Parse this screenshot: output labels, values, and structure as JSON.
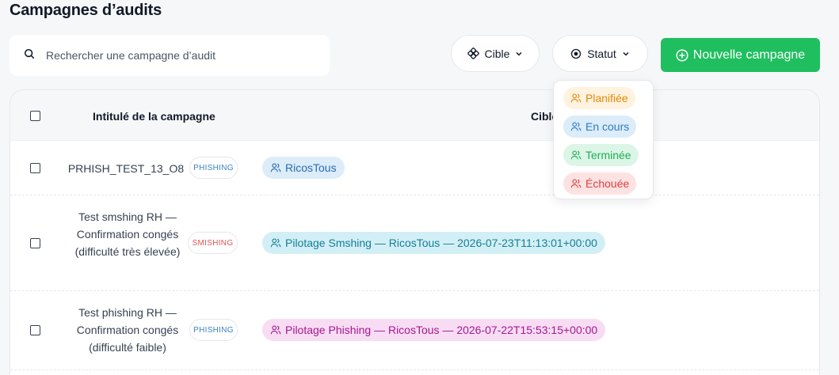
{
  "page": {
    "title": "Campagnes d’audits"
  },
  "search": {
    "placeholder": "Rechercher une campagne d’audit",
    "value": ""
  },
  "filters": {
    "cible_label": "Cible",
    "statut_label": "Statut"
  },
  "new_campaign": {
    "label": "Nouvelle campagne"
  },
  "table": {
    "headers": {
      "title": "Intitulé de la campagne",
      "cible": "Cible"
    },
    "rows": [
      {
        "name": "PRHISH_TEST_13_O8",
        "type": "PHISHING",
        "target": "RicosTous"
      },
      {
        "name": "Test smshing RH — Confirmation congés (difficulté très élevée)",
        "type": "SMISHING",
        "target": "Pilotage Smshing — RicosTous — 2026-07-23T11:13:01+00:00"
      },
      {
        "name": "Test phishing RH — Confirmation congés (difficulté faible)",
        "type": "PHISHING",
        "target": "Pilotage Phishing — RicosTous — 2026-07-22T15:53:15+00:00"
      }
    ]
  },
  "status_dropdown": {
    "options": [
      {
        "label": "Planifiée",
        "color": "#e08a0a"
      },
      {
        "label": "En cours",
        "color": "#2b7cc4"
      },
      {
        "label": "Terminée",
        "color": "#1fae57"
      },
      {
        "label": "Échouée",
        "color": "#dd4040"
      }
    ]
  },
  "colors": {
    "accent": "#1fbf5f"
  }
}
